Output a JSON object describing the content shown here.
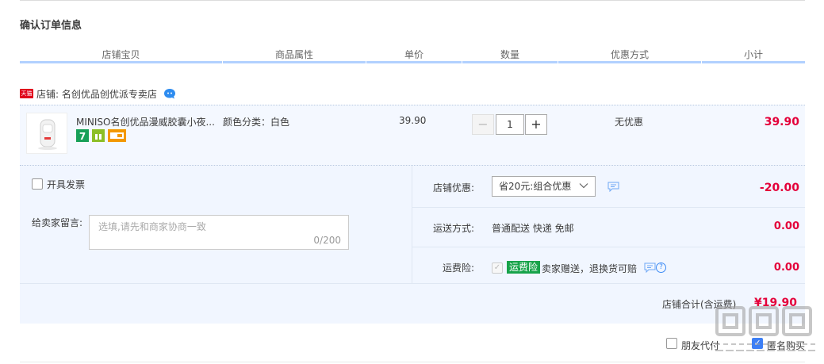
{
  "section_title": "确认订单信息",
  "columns": [
    "店铺宝贝",
    "商品属性",
    "单价",
    "数量",
    "优惠方式",
    "小计"
  ],
  "shop": {
    "badge": "天猫",
    "label": "店铺: 名创优品创优派专卖店",
    "chat_icon": "wangwang-chat-icon"
  },
  "item": {
    "title": "MINISO名创优品漫威胶囊小夜...",
    "attribute": "颜色分类：白色",
    "unit_price": "39.90",
    "quantity": "1",
    "minus": "−",
    "plus": "+",
    "discount": "无优惠",
    "subtotal": "39.90",
    "service_icons": [
      "seven-day-return-icon",
      "gift-icon",
      "credit-card-icon"
    ]
  },
  "invoice": {
    "label": "开具发票",
    "checked": false
  },
  "message": {
    "label": "给卖家留言:",
    "placeholder": "选填,请先和商家协商一致",
    "counter": "0/200"
  },
  "shop_promo": {
    "label": "店铺优惠:",
    "selected": "省20元:组合优惠",
    "amount": "-20.00"
  },
  "shipping": {
    "label": "运送方式:",
    "value": "普通配送 快递 免邮",
    "amount": "0.00"
  },
  "insurance": {
    "label": "运费险:",
    "badge": "运费险",
    "text": "卖家赠送，退换货可赔",
    "amount": "0.00"
  },
  "shop_total": {
    "label": "店铺合计(含运费)",
    "value": "¥19.90"
  },
  "options": {
    "friend_pay": {
      "label": "朋友代付",
      "checked": false
    },
    "anonymous": {
      "label": "匿名购买",
      "checked": true
    }
  },
  "colors": {
    "price_red": "#e4003a",
    "accent_blue": "#3d7ff5",
    "header_rule": "#b2d1ff",
    "panel_bg": "#f1f6ff",
    "insurance_green": "#17a34a"
  }
}
